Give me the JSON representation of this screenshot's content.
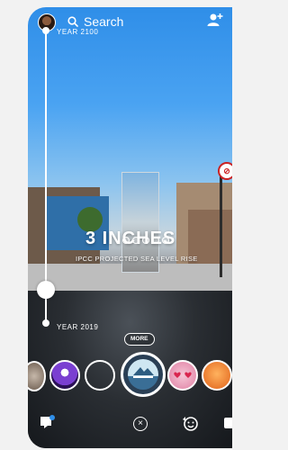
{
  "header": {
    "search_label": "Search",
    "icons": [
      "search-icon",
      "add-friend-icon"
    ]
  },
  "slider": {
    "year_top": "YEAR 2100",
    "year_bottom": "YEAR 2019"
  },
  "overlay": {
    "big_text": "3 INCHES",
    "sub_text": "IPCC PROJECTED SEA LEVEL RISE",
    "more_label": "MORE"
  },
  "scene": {
    "sign_glyph": "⊘"
  },
  "bottom": {
    "close_glyph": "×"
  },
  "colors": {
    "sky": "#4aa3f2",
    "water": "#1b1f24",
    "lens_purple": "#7a3fd1",
    "lens_orange": "#e0621a"
  }
}
